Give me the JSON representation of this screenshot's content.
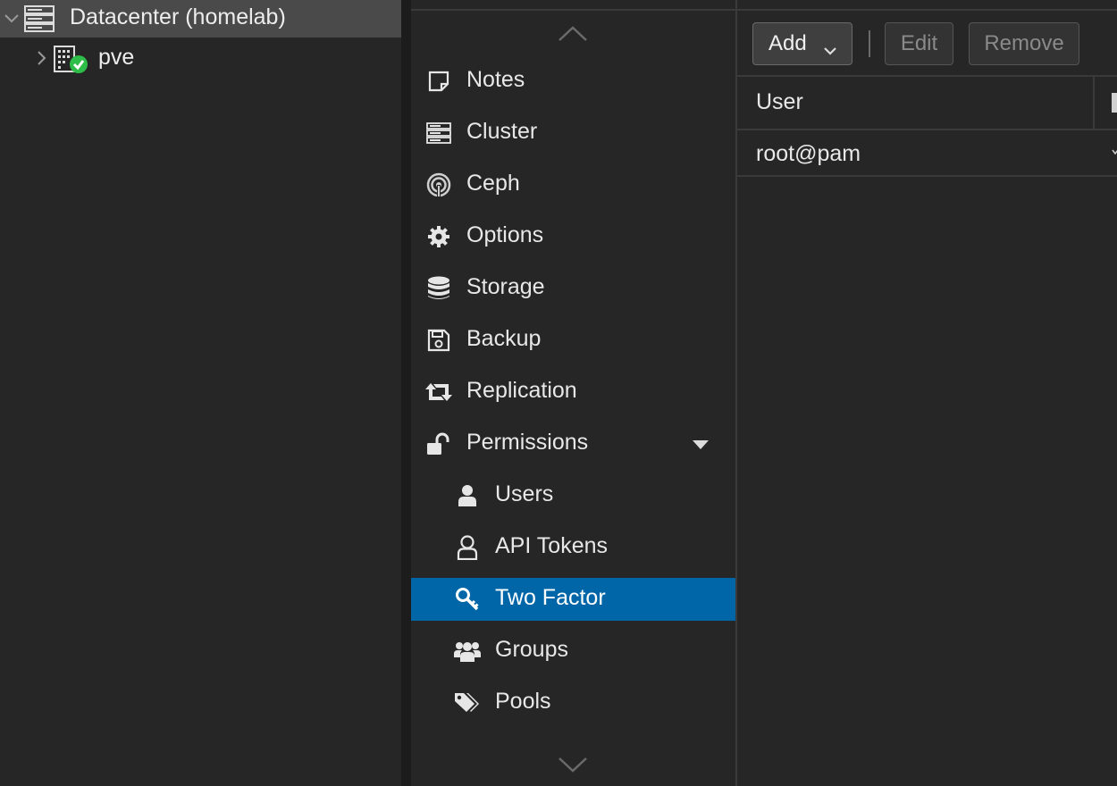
{
  "tree": {
    "root_label": "Datacenter (homelab)",
    "node_label": "pve"
  },
  "nav": {
    "items": [
      {
        "label": "Notes",
        "icon": "notes-icon"
      },
      {
        "label": "Cluster",
        "icon": "cluster-icon"
      },
      {
        "label": "Ceph",
        "icon": "ceph-icon"
      },
      {
        "label": "Options",
        "icon": "gear-icon"
      },
      {
        "label": "Storage",
        "icon": "database-icon"
      },
      {
        "label": "Backup",
        "icon": "floppy-disk-icon"
      },
      {
        "label": "Replication",
        "icon": "retweet-icon"
      },
      {
        "label": "Permissions",
        "icon": "unlock-icon"
      },
      {
        "label": "Users",
        "icon": "user-icon"
      },
      {
        "label": "API Tokens",
        "icon": "user-outline-icon"
      },
      {
        "label": "Two Factor",
        "icon": "key-icon"
      },
      {
        "label": "Groups",
        "icon": "users-icon"
      },
      {
        "label": "Pools",
        "icon": "tags-icon"
      }
    ],
    "selected": "Two Factor"
  },
  "toolbar": {
    "add_label": "Add",
    "edit_label": "Edit",
    "remove_label": "Remove"
  },
  "grid": {
    "columns": [
      "User"
    ],
    "rows": [
      {
        "user": "root@pam"
      }
    ]
  },
  "colors": {
    "selected_bg": "#0066a8",
    "tree_selected_bg": "#4a4a4a",
    "status_ok": "#2ebd48"
  }
}
